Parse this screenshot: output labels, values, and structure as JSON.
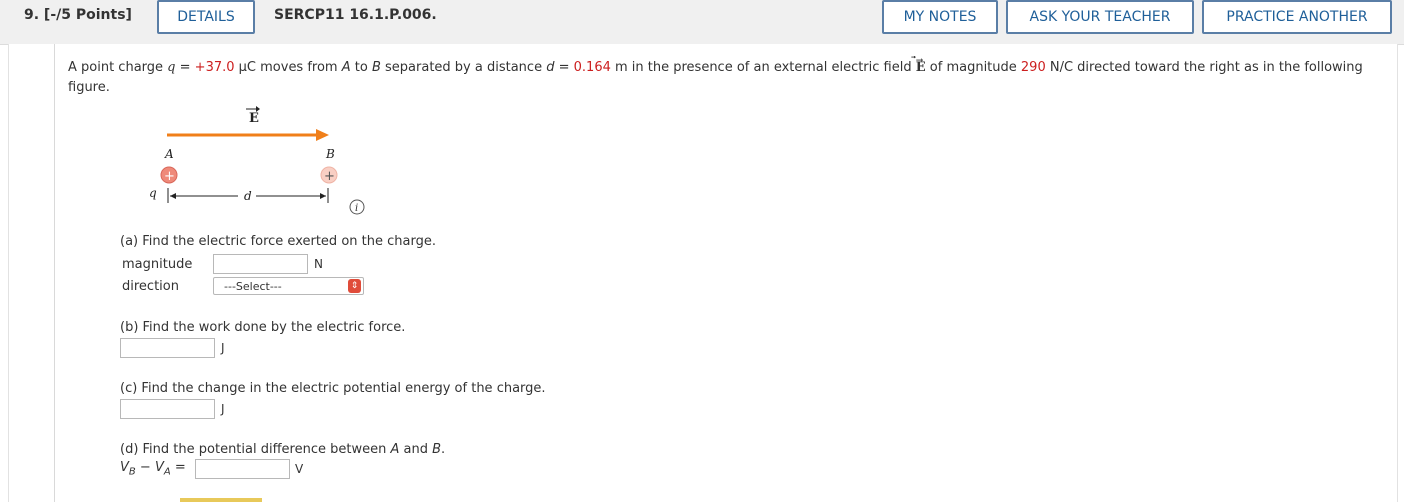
{
  "header": {
    "question_number": "9. [-/5 Points]",
    "details_label": "DETAILS",
    "code": "SERCP11 16.1.P.006.",
    "my_notes_label": "MY NOTES",
    "ask_teacher_label": "ASK YOUR TEACHER",
    "practice_label": "PRACTICE ANOTHER"
  },
  "intro": {
    "p1": "A point charge ",
    "q_var": "q",
    "p2": " = ",
    "q_value": "+37.0",
    "p3": " μC moves from ",
    "A": "A",
    "p4": " to ",
    "B": "B",
    "p5": " separated by a distance ",
    "d_var": "d",
    "p6": " = ",
    "d_value": "0.164",
    "p7": " m in the presence of an external electric field ",
    "E": "E",
    "p8": " of magnitude ",
    "E_value": "290",
    "p9": " N/C directed toward the right as in the following figure."
  },
  "figure": {
    "E_label": "E",
    "A_label": "A",
    "B_label": "B",
    "q_label": "q",
    "d_label": "d",
    "plus": "+",
    "info": "i",
    "arrow_color": "#f07f1a",
    "charge_color_A": "#ef8a7a",
    "charge_color_B": "#f9cfc4"
  },
  "parts": {
    "a_text": "(a) Find the electric force exerted on the charge.",
    "a_magnitude_label": "magnitude",
    "a_unit": "N",
    "a_direction_label": "direction",
    "a_select_value": "---Select---",
    "b_text": "(b) Find the work done by the electric force.",
    "b_unit": "J",
    "c_text": "(c) Find the change in the electric potential energy of the charge.",
    "c_unit": "J",
    "d_text_pre": "(d) Find the potential difference between ",
    "d_A": "A",
    "d_and": " and ",
    "d_B": "B",
    "d_dot": ".",
    "d_V": "V",
    "d_sub_B": "B",
    "d_minus": " − ",
    "d_sub_A": "A",
    "d_eq": " =",
    "d_unit": "V"
  }
}
